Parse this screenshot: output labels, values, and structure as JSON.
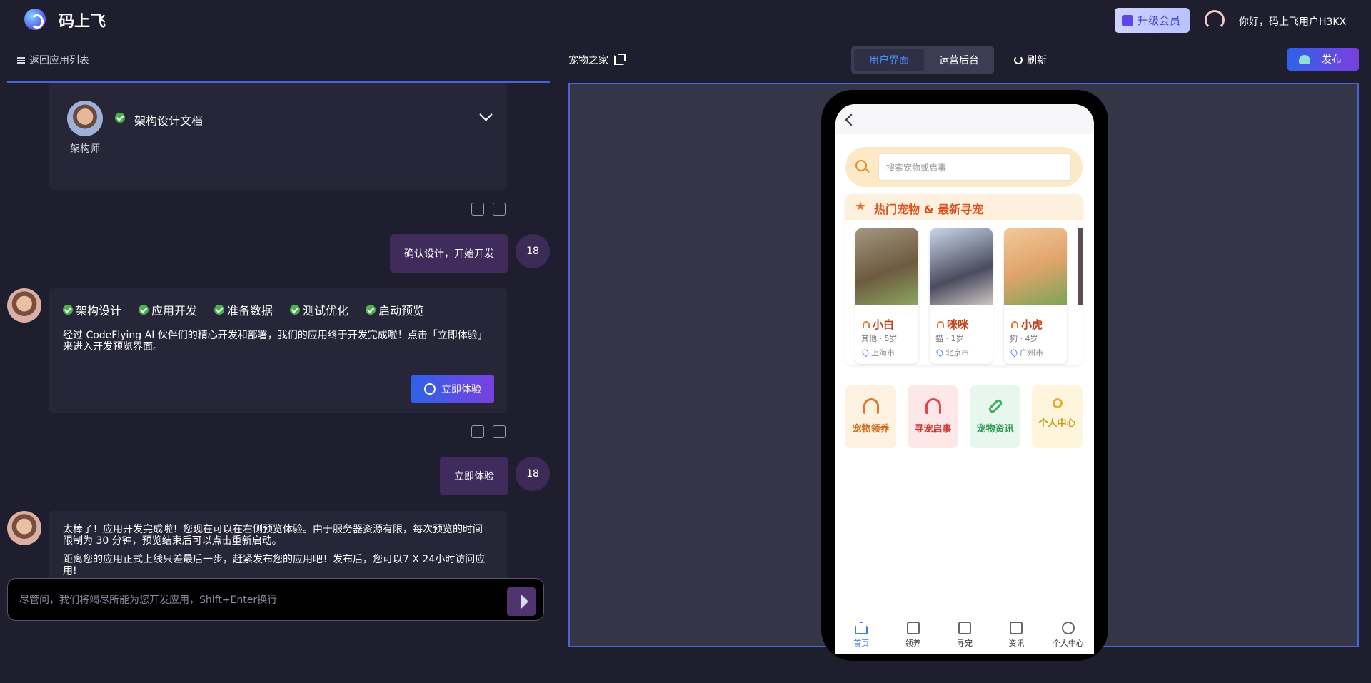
{
  "header": {
    "brand": "码上飞",
    "upgrade_label": "升级会员",
    "greeting": "你好，码上飞用户H3KX"
  },
  "left_toolbar": {
    "back_label": "返回应用列表"
  },
  "chat": {
    "arch_card": {
      "doc_title": "架构设计文档",
      "role": "架构师"
    },
    "user_msg_1": {
      "text": "确认设计，开始开发",
      "avatar": "18"
    },
    "progress_card": {
      "steps": [
        "架构设计",
        "应用开发",
        "准备数据",
        "测试优化",
        "启动预览"
      ],
      "body": "经过 CodeFlying AI 伙伴们的精心开发和部署，我们的应用终于开发完成啦！点击「立即体验」来进入开发预览界面。",
      "try_label": "立即体验"
    },
    "user_msg_2": {
      "text": "立即体验",
      "avatar": "18"
    },
    "final_card": {
      "p1": "太棒了！应用开发完成啦！您现在可以在右侧预览体验。由于服务器资源有限，每次预览的时间限制为 30 分钟，预览结束后可以点击重新启动。",
      "p2": "距离您的应用正式上线只差最后一步，赶紧发布您的应用吧！发布后，您可以7 X 24小时访问应用!"
    },
    "input_placeholder": "尽管问，我们将竭尽所能为您开发应用，Shift+Enter换行"
  },
  "right_toolbar": {
    "app_name": "宠物之家",
    "tab_user": "用户界面",
    "tab_admin": "运营后台",
    "refresh_label": "刷新",
    "publish_label": "发布"
  },
  "phone": {
    "search_placeholder": "搜索宠物或启事",
    "hot_title": "热门宠物 & 最新寻宠",
    "pets": [
      {
        "name": "小白",
        "meta": "其他 · 5岁",
        "location": "上海市"
      },
      {
        "name": "咪咪",
        "meta": "猫 · 1岁",
        "location": "北京市"
      },
      {
        "name": "小虎",
        "meta": "狗 · 4岁",
        "location": "广州市"
      }
    ],
    "features": [
      "宠物领养",
      "寻宠启事",
      "宠物资讯",
      "个人中心"
    ],
    "tabbar": [
      "首页",
      "领养",
      "寻宠",
      "资讯",
      "个人中心"
    ]
  }
}
